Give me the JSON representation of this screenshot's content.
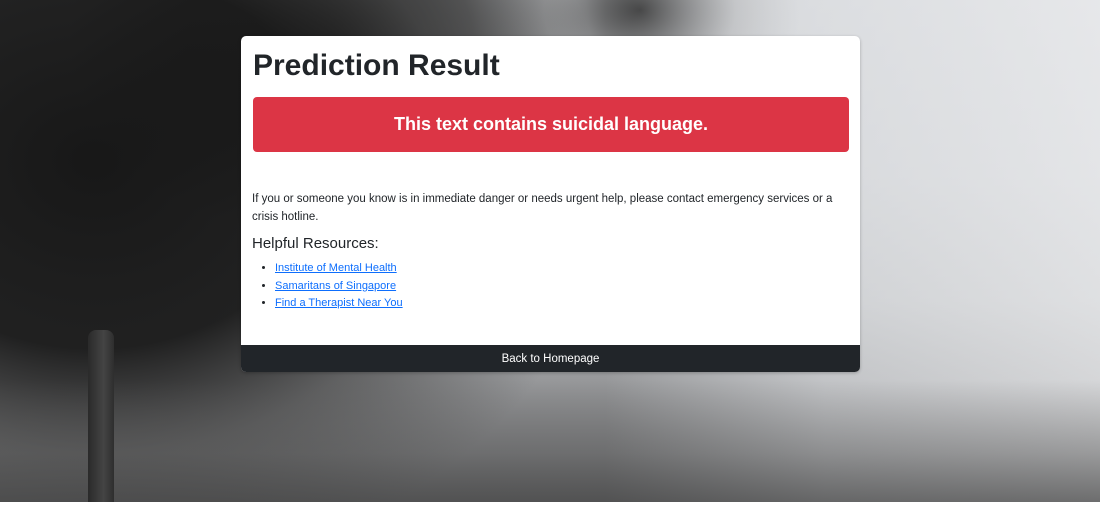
{
  "card": {
    "title": "Prediction Result",
    "alert_text": "This text contains suicidal language.",
    "message": "If you or someone you know is in immediate danger or needs urgent help, please contact emergency services or a crisis hotline.",
    "resources_heading": "Helpful Resources:",
    "resources": [
      {
        "label": "Institute of Mental Health"
      },
      {
        "label": "Samaritans of Singapore"
      },
      {
        "label": "Find a Therapist Near You"
      }
    ],
    "back_button_label": "Back to Homepage"
  },
  "colors": {
    "alert_bg": "#dc3545",
    "button_bg": "#212529",
    "link": "#0d6efd"
  }
}
